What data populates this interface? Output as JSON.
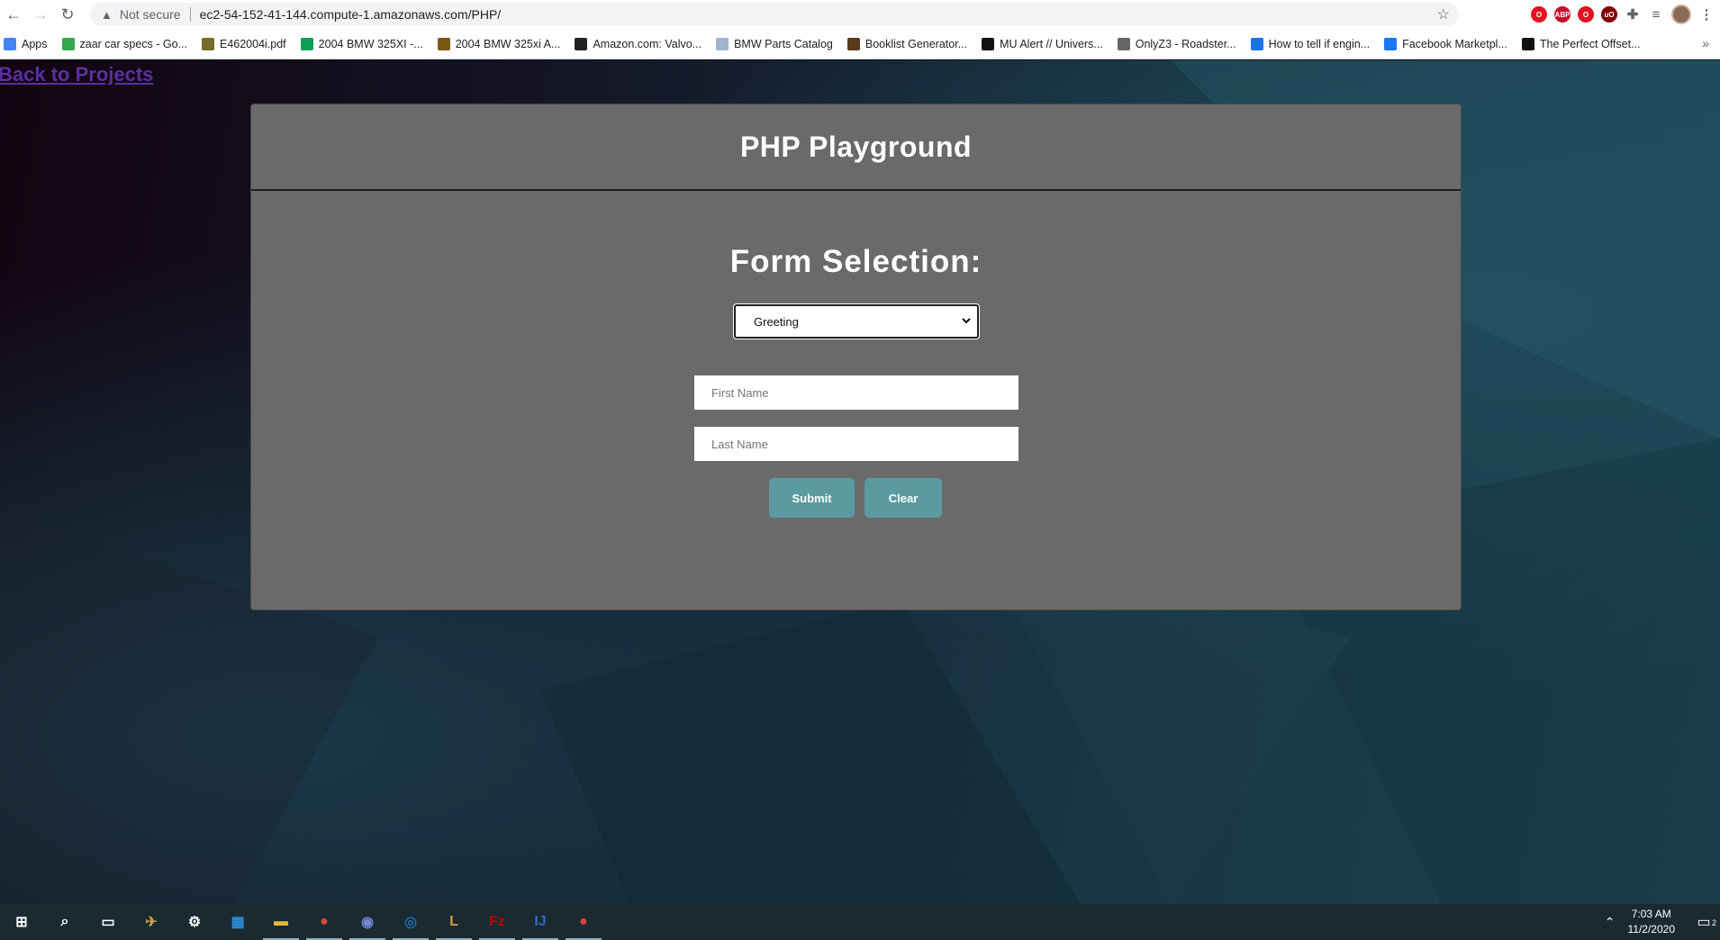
{
  "browser": {
    "security_label": "Not secure",
    "url": "ec2-54-152-41-144.compute-1.amazonaws.com/PHP/",
    "bookmarks": [
      {
        "label": "Apps",
        "icon": "apps-grid-icon",
        "color": "#4285f4"
      },
      {
        "label": "zaar car specs - Go...",
        "icon": "google-drive-icon",
        "color": "#34a853"
      },
      {
        "label": "E462004i.pdf",
        "icon": "image-icon",
        "color": "#7a6a2a"
      },
      {
        "label": "2004 BMW 325XI -...",
        "icon": "google-sheets-icon",
        "color": "#0f9d58"
      },
      {
        "label": "2004 BMW 325xi A...",
        "icon": "hexagon-icon",
        "color": "#7a5a10"
      },
      {
        "label": "Amazon.com: Valvo...",
        "icon": "amazon-icon",
        "color": "#222222"
      },
      {
        "label": "BMW Parts Catalog",
        "icon": "page-icon",
        "color": "#a0b4d0"
      },
      {
        "label": "Booklist Generator...",
        "icon": "circle-logo-icon",
        "color": "#5a3a1a"
      },
      {
        "label": "MU Alert // Univers...",
        "icon": "mu-tiger-icon",
        "color": "#111111"
      },
      {
        "label": "OnlyZ3 - Roadster...",
        "icon": "z3-logo-icon",
        "color": "#666666"
      },
      {
        "label": "How to tell if engin...",
        "icon": "v-logo-icon",
        "color": "#1a73e8"
      },
      {
        "label": "Facebook Marketpl...",
        "icon": "facebook-icon",
        "color": "#1877f2"
      },
      {
        "label": "The Perfect Offset...",
        "icon": "z-logo-icon",
        "color": "#111111"
      }
    ],
    "extensions": [
      {
        "name": "opera-icon",
        "color": "#e0121f",
        "text": "O"
      },
      {
        "name": "adblock-plus-icon",
        "color": "#c70d2c",
        "text": "ABP"
      },
      {
        "name": "opera-red-icon",
        "color": "#e0121f",
        "text": "O"
      },
      {
        "name": "ublock-origin-icon",
        "color": "#800000",
        "text": "uO"
      }
    ]
  },
  "page": {
    "back_link": "Back to Projects",
    "card_title": "PHP Playground",
    "section_title": "Form Selection:",
    "form_select_value": "Greeting",
    "first_name_placeholder": "First Name",
    "last_name_placeholder": "Last Name",
    "submit_label": "Submit",
    "clear_label": "Clear"
  },
  "taskbar": {
    "time": "7:03 AM",
    "date": "11/2/2020",
    "notification_count": "2",
    "apps": [
      {
        "name": "start-icon",
        "color": "#ffffff",
        "text": "⊞",
        "active": false
      },
      {
        "name": "search-icon",
        "color": "#ffffff",
        "text": "⌕",
        "active": false
      },
      {
        "name": "task-view-icon",
        "color": "#ffffff",
        "text": "▭",
        "active": false
      },
      {
        "name": "jet-app-icon",
        "color": "#c9a24a",
        "text": "✈",
        "active": false
      },
      {
        "name": "settings-gear-icon",
        "color": "#ffffff",
        "text": "⚙",
        "active": false
      },
      {
        "name": "control-panel-icon",
        "color": "#2d8fd8",
        "text": "▦",
        "active": false
      },
      {
        "name": "file-explorer-icon",
        "color": "#e8b73a",
        "text": "▬",
        "active": true
      },
      {
        "name": "chrome-icon",
        "color": "#db4437",
        "text": "●",
        "active": true
      },
      {
        "name": "discord-icon",
        "color": "#7289da",
        "text": "◉",
        "active": true
      },
      {
        "name": "steam-icon",
        "color": "#1b6ea8",
        "text": "◎",
        "active": true
      },
      {
        "name": "league-of-legends-icon",
        "color": "#c8a046",
        "text": "L",
        "active": true
      },
      {
        "name": "filezilla-icon",
        "color": "#bf0000",
        "text": "Fz",
        "active": true
      },
      {
        "name": "intellij-icon",
        "color": "#2a6fc9",
        "text": "IJ",
        "active": true
      },
      {
        "name": "chrome-2-icon",
        "color": "#db4437",
        "text": "●",
        "active": true
      }
    ]
  }
}
